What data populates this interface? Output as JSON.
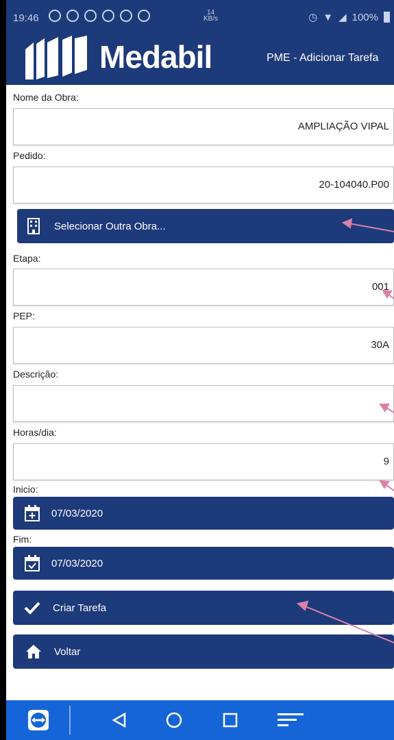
{
  "status_bar": {
    "time": "19:46",
    "speed_value": "14",
    "speed_unit": "KB/s",
    "battery": "100%"
  },
  "header": {
    "brand": "Medabil",
    "screen_title": "PME - Adicionar Tarefa",
    "colors": {
      "primary": "#1d3a7a",
      "nav": "#1565d8"
    }
  },
  "form": {
    "nome_obra": {
      "label": "Nome da Obra:",
      "value": "AMPLIAÇÃO VIPAL"
    },
    "pedido": {
      "label": "Pedido:",
      "value": "20-104040.P00"
    },
    "selecionar_obra": {
      "label": "Selecionar Outra Obra...",
      "icon": "building-icon"
    },
    "etapa": {
      "label": "Etapa:",
      "value": "001"
    },
    "pep": {
      "label": "PEP:",
      "value": "30A"
    },
    "descricao": {
      "label": "Descrição:",
      "value": ""
    },
    "horas_dia": {
      "label": "Horas/dia:",
      "value": "9"
    },
    "inicio": {
      "label": "Inicio:",
      "value": "07/03/2020",
      "icon": "calendar-plus-icon"
    },
    "fim": {
      "label": "Fim:",
      "value": "07/03/2020",
      "icon": "calendar-check-icon"
    }
  },
  "actions": {
    "criar": {
      "label": "Criar Tarefa",
      "icon": "check-icon"
    },
    "voltar": {
      "label": "Voltar",
      "icon": "home-icon"
    }
  },
  "nav_bar": {
    "items": [
      "teamviewer-icon",
      "back-icon",
      "home-icon",
      "recents-icon",
      "menu-icon"
    ]
  }
}
